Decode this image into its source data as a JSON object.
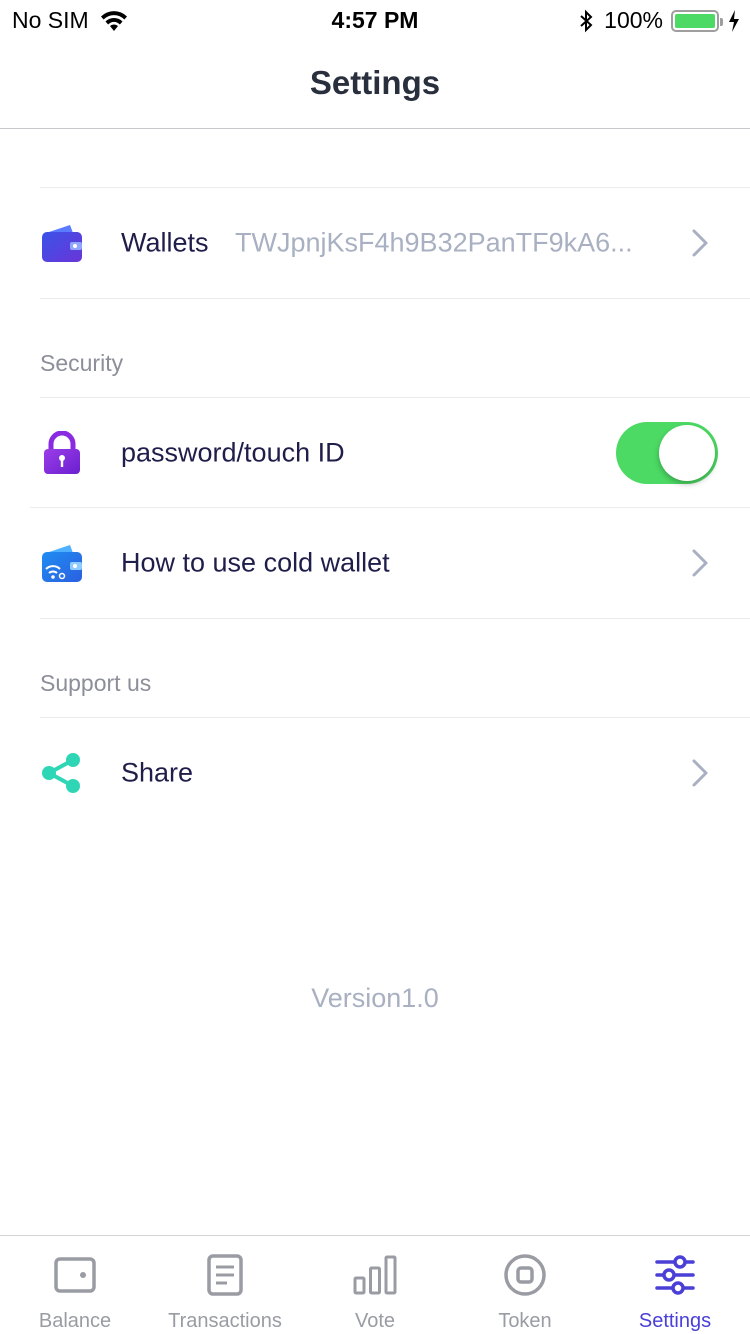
{
  "status_bar": {
    "carrier": "No SIM",
    "time": "4:57 PM",
    "battery": "100%"
  },
  "nav": {
    "title": "Settings"
  },
  "wallets_row": {
    "label": "Wallets",
    "value": "TWJpnjKsF4h9B32PanTF9kA6..."
  },
  "sections": {
    "security": "Security",
    "support": "Support us"
  },
  "security_items": {
    "password": {
      "label": "password/touch ID",
      "toggle_on": true
    },
    "cold_wallet": {
      "label": "How to use cold wallet"
    }
  },
  "support_items": {
    "share": {
      "label": "Share"
    }
  },
  "version": "Version1.0",
  "tabs": [
    {
      "label": "Balance",
      "icon": "wallet-icon"
    },
    {
      "label": "Transactions",
      "icon": "document-icon"
    },
    {
      "label": "Vote",
      "icon": "bar-chart-icon"
    },
    {
      "label": "Token",
      "icon": "token-icon"
    },
    {
      "label": "Settings",
      "icon": "sliders-icon",
      "active": true
    }
  ],
  "colors": {
    "accent": "#4a3fd6",
    "toggle_on": "#4cd964",
    "muted_text": "#a8b0c2",
    "share_icon": "#2fd6b5",
    "lock_icon": "#8a2be2"
  }
}
